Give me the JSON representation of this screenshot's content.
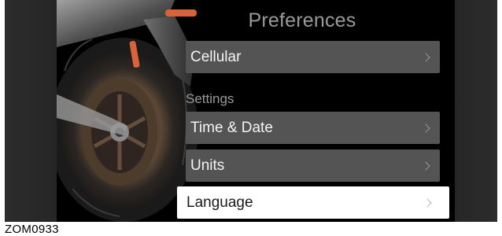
{
  "screen": {
    "title": "Preferences",
    "section_label": "Settings"
  },
  "menu": {
    "items": [
      {
        "label": "Cellular",
        "selected": false
      },
      {
        "label": "Time & Date",
        "selected": false
      },
      {
        "label": "Units",
        "selected": false
      },
      {
        "label": "Language",
        "selected": true
      }
    ]
  },
  "figure": {
    "code": "ZOM0933"
  },
  "colors": {
    "screen_background": "#000000",
    "menu_item": "#545454",
    "menu_item_selected": "#ffffff",
    "muted_text": "#9a9a9a"
  },
  "icons": {
    "chevron": "chevron-right-icon",
    "background": "motorcycle-image"
  }
}
